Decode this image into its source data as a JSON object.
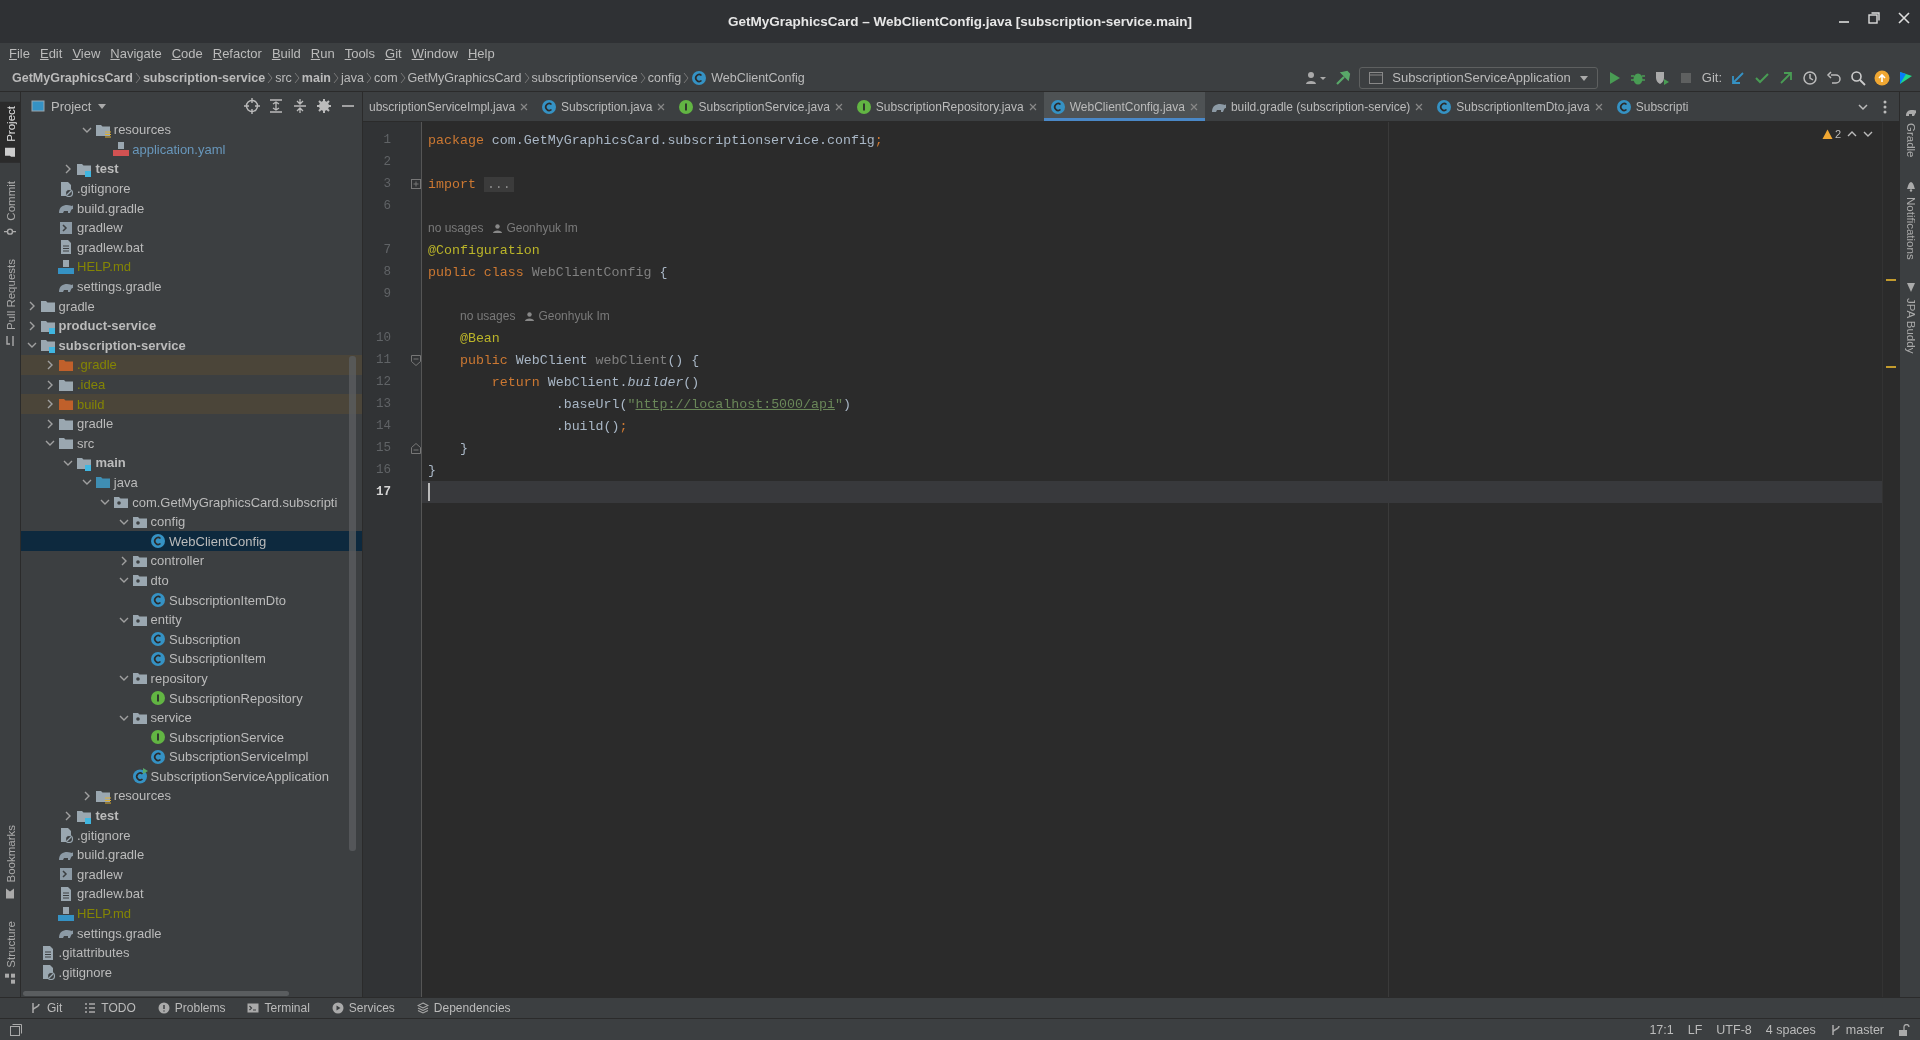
{
  "window": {
    "title": "GetMyGraphicsCard – WebClientConfig.java [subscription-service.main]"
  },
  "menu": [
    "File",
    "Edit",
    "View",
    "Navigate",
    "Code",
    "Refactor",
    "Build",
    "Run",
    "Tools",
    "Git",
    "Window",
    "Help"
  ],
  "breadcrumbs": [
    {
      "label": "GetMyGraphicsCard",
      "kind": "module"
    },
    {
      "label": "subscription-service",
      "kind": "module"
    },
    {
      "label": "src",
      "kind": "folder"
    },
    {
      "label": "main",
      "kind": "module"
    },
    {
      "label": "java",
      "kind": "folder"
    },
    {
      "label": "com",
      "kind": "folder"
    },
    {
      "label": "GetMyGraphicsCard",
      "kind": "folder"
    },
    {
      "label": "subscriptionservice",
      "kind": "folder"
    },
    {
      "label": "config",
      "kind": "folder"
    },
    {
      "label": "WebClientConfig",
      "kind": "class"
    }
  ],
  "toolbar": {
    "run_configuration": "SubscriptionServiceApplication",
    "git_label": "Git:"
  },
  "left_tool_windows": {
    "top": [
      {
        "label": "Project",
        "selected": true
      },
      {
        "label": "Commit",
        "selected": false
      },
      {
        "label": "Pull Requests",
        "selected": false
      }
    ],
    "bottom": [
      {
        "label": "Bookmarks",
        "selected": false
      },
      {
        "label": "Structure",
        "selected": false
      }
    ]
  },
  "right_tool_windows": [
    {
      "label": "Gradle",
      "kind": "gradle"
    },
    {
      "label": "Notifications",
      "kind": "bell"
    },
    {
      "label": "JPA Buddy",
      "kind": "jpa"
    }
  ],
  "project_panel": {
    "title": "Project",
    "tree": [
      {
        "children": [
          {
            "children": [
              {
                "children": [
                  {
                    "label": "resources",
                    "kind": "resources",
                    "expanded": true,
                    "selected": false,
                    "children": [
                      {
                        "label": "application.yaml",
                        "kind": "yaml",
                        "color": "#6897bb",
                        "selected": false
                      }
                    ]
                  }
                ]
              },
              {
                "label": "test",
                "kind": "module",
                "expanded": false,
                "selected": false
              }
            ]
          },
          {
            "label": ".gitignore",
            "kind": "gitignore",
            "selected": false
          },
          {
            "label": "build.gradle",
            "kind": "gradle",
            "selected": false
          },
          {
            "label": "gradlew",
            "kind": "script",
            "selected": false
          },
          {
            "label": "gradlew.bat",
            "kind": "text",
            "selected": false
          },
          {
            "label": "HELP.md",
            "kind": "markdown",
            "color": "#848504",
            "selected": false
          },
          {
            "label": "settings.gradle",
            "kind": "gradle",
            "selected": false
          }
        ]
      },
      {
        "label": "gradle",
        "kind": "folder",
        "expanded": false,
        "selected": false
      },
      {
        "label": "product-service",
        "kind": "module",
        "expanded": false,
        "selected": false
      },
      {
        "label": "subscription-service",
        "kind": "module",
        "expanded": true,
        "selected": false,
        "children": [
          {
            "label": ".gradle",
            "kind": "excluded",
            "color": "#848504",
            "expanded": false,
            "selected": false
          },
          {
            "label": ".idea",
            "kind": "folder",
            "color": "#848504",
            "expanded": false,
            "selected": false
          },
          {
            "label": "build",
            "kind": "excluded",
            "color": "#848504",
            "expanded": false,
            "selected": false
          },
          {
            "label": "gradle",
            "kind": "folder",
            "expanded": false,
            "selected": false
          },
          {
            "label": "src",
            "kind": "folder",
            "expanded": true,
            "selected": false,
            "children": [
              {
                "label": "main",
                "kind": "module",
                "expanded": true,
                "selected": false,
                "children": [
                  {
                    "label": "java",
                    "kind": "source",
                    "expanded": true,
                    "selected": false,
                    "children": [
                      {
                        "label": "com.GetMyGraphicsCard.subscripti",
                        "kind": "package",
                        "expanded": true,
                        "selected": false,
                        "children": [
                          {
                            "label": "config",
                            "kind": "package",
                            "expanded": true,
                            "selected": false,
                            "children": [
                              {
                                "label": "WebClientConfig",
                                "kind": "class",
                                "selected": true
                              }
                            ]
                          },
                          {
                            "label": "controller",
                            "kind": "package",
                            "expanded": false,
                            "selected": false
                          },
                          {
                            "label": "dto",
                            "kind": "package",
                            "expanded": true,
                            "selected": false,
                            "children": [
                              {
                                "label": "SubscriptionItemDto",
                                "kind": "class",
                                "selected": false
                              }
                            ]
                          },
                          {
                            "label": "entity",
                            "kind": "package",
                            "expanded": true,
                            "selected": false,
                            "children": [
                              {
                                "label": "Subscription",
                                "kind": "class",
                                "selected": false
                              },
                              {
                                "label": "SubscriptionItem",
                                "kind": "class",
                                "selected": false
                              }
                            ]
                          },
                          {
                            "label": "repository",
                            "kind": "package",
                            "expanded": true,
                            "selected": false,
                            "children": [
                              {
                                "label": "SubscriptionRepository",
                                "kind": "interface",
                                "selected": false
                              }
                            ]
                          },
                          {
                            "label": "service",
                            "kind": "package",
                            "expanded": true,
                            "selected": false,
                            "children": [
                              {
                                "label": "SubscriptionService",
                                "kind": "interface",
                                "selected": false
                              },
                              {
                                "label": "SubscriptionServiceImpl",
                                "kind": "class",
                                "selected": false
                              }
                            ]
                          },
                          {
                            "label": "SubscriptionServiceApplication",
                            "kind": "app",
                            "selected": false
                          }
                        ]
                      }
                    ]
                  },
                  {
                    "label": "resources",
                    "kind": "resources",
                    "expanded": false,
                    "selected": false
                  }
                ]
              },
              {
                "label": "test",
                "kind": "module",
                "expanded": false,
                "selected": false
              }
            ]
          },
          {
            "label": ".gitignore",
            "kind": "gitignore",
            "selected": false
          },
          {
            "label": "build.gradle",
            "kind": "gradle",
            "selected": false
          },
          {
            "label": "gradlew",
            "kind": "script",
            "selected": false
          },
          {
            "label": "gradlew.bat",
            "kind": "text",
            "selected": false
          },
          {
            "label": "HELP.md",
            "kind": "markdown",
            "color": "#848504",
            "selected": false
          },
          {
            "label": "settings.gradle",
            "kind": "gradle",
            "selected": false
          }
        ]
      },
      {
        "label": ".gitattributes",
        "kind": "text",
        "selected": false
      },
      {
        "label": ".gitignore",
        "kind": "gitignore",
        "selected": false
      }
    ]
  },
  "editor_tabs": [
    {
      "label": "ubscriptionServiceImpl.java",
      "kind": "cut",
      "selected": false,
      "closable": true
    },
    {
      "label": "Subscription.java",
      "kind": "class",
      "selected": false,
      "closable": true
    },
    {
      "label": "SubscriptionService.java",
      "kind": "interface",
      "selected": false,
      "closable": true
    },
    {
      "label": "SubscriptionRepository.java",
      "kind": "interface",
      "selected": false,
      "closable": true
    },
    {
      "label": "WebClientConfig.java",
      "kind": "class",
      "selected": true,
      "closable": true
    },
    {
      "label": "build.gradle (subscription-service)",
      "kind": "gradle",
      "selected": false,
      "closable": true
    },
    {
      "label": "SubscriptionItemDto.java",
      "kind": "class",
      "selected": false,
      "closable": true
    },
    {
      "label": "Subscripti",
      "kind": "class",
      "selected": false,
      "closable": false
    }
  ],
  "editor": {
    "problems_count": "2",
    "lines": [
      {
        "kind": "code",
        "number": "1",
        "current": false,
        "tokens": [
          {
            "text": "package",
            "kind": "keyword"
          },
          {
            "text": " com.GetMyGraphicsCard.subscriptionservice.config",
            "kind": "plain"
          },
          {
            "text": ";",
            "kind": "keyword"
          }
        ]
      },
      {
        "kind": "code",
        "number": "2",
        "current": false
      },
      {
        "kind": "folded",
        "number": "3",
        "current": false,
        "tokens": [
          {
            "text": "import",
            "kind": "keyword"
          },
          {
            "text": "...",
            "kind": "folded"
          }
        ]
      },
      {
        "kind": "code",
        "number": "6",
        "current": false
      },
      {
        "kind": "hint",
        "indented": false,
        "usages": "no usages",
        "author": "Geonhyuk Im"
      },
      {
        "kind": "code",
        "number": "7",
        "current": false,
        "tokens": [
          {
            "text": "@Configuration",
            "kind": "annotation"
          }
        ]
      },
      {
        "kind": "code",
        "number": "8",
        "current": false,
        "tokens": [
          {
            "text": "public class",
            "kind": "keyword"
          },
          {
            "text": " WebClientConfig",
            "kind": "unused"
          },
          {
            "text": " {",
            "kind": "plain"
          }
        ]
      },
      {
        "kind": "code",
        "number": "9",
        "current": false
      },
      {
        "kind": "hint",
        "indented": true,
        "usages": "no usages",
        "author": "Geonhyuk Im"
      },
      {
        "kind": "code",
        "number": "10",
        "current": false,
        "tokens": [
          {
            "text": "    @Bean",
            "kind": "annotation"
          }
        ]
      },
      {
        "kind": "block-start",
        "number": "11",
        "current": false,
        "tokens": [
          {
            "text": "    public",
            "kind": "keyword"
          },
          {
            "text": " WebClient",
            "kind": "plain"
          },
          {
            "text": " webClient",
            "kind": "unused"
          },
          {
            "text": "() {",
            "kind": "plain"
          }
        ]
      },
      {
        "kind": "code",
        "number": "12",
        "current": false,
        "tokens": [
          {
            "text": "        return",
            "kind": "keyword"
          },
          {
            "text": " WebClient.",
            "kind": "plain"
          },
          {
            "text": "builder",
            "kind": "static"
          },
          {
            "text": "()",
            "kind": "plain"
          }
        ]
      },
      {
        "kind": "code",
        "number": "13",
        "current": false,
        "tokens": [
          {
            "text": "                .baseUrl(",
            "kind": "plain"
          },
          {
            "text": "\"",
            "kind": "string"
          },
          {
            "text": "http://localhost:5000/api",
            "kind": "link"
          },
          {
            "text": "\"",
            "kind": "string"
          },
          {
            "text": ")",
            "kind": "plain"
          }
        ]
      },
      {
        "kind": "code",
        "number": "14",
        "current": false,
        "tokens": [
          {
            "text": "                .build()",
            "kind": "plain"
          },
          {
            "text": ";",
            "kind": "keyword"
          }
        ]
      },
      {
        "kind": "block-end",
        "number": "15",
        "current": false,
        "tokens": [
          {
            "text": "    }",
            "kind": "plain"
          }
        ]
      },
      {
        "kind": "code",
        "number": "16",
        "current": false,
        "tokens": [
          {
            "text": "}",
            "kind": "plain"
          }
        ]
      },
      {
        "kind": "code",
        "number": "17",
        "current": true
      }
    ]
  },
  "bottom_tool_windows": [
    {
      "label": "Git",
      "kind": "git"
    },
    {
      "label": "TODO",
      "kind": "todo"
    },
    {
      "label": "Problems",
      "kind": "problems"
    },
    {
      "label": "Terminal",
      "kind": "terminal"
    },
    {
      "label": "Services",
      "kind": "services"
    },
    {
      "label": "Dependencies",
      "kind": "dependencies"
    }
  ],
  "status_bar": {
    "caret": "17:1",
    "line_separator": "LF",
    "encoding": "UTF-8",
    "indent": "4 spaces",
    "branch": "master"
  }
}
